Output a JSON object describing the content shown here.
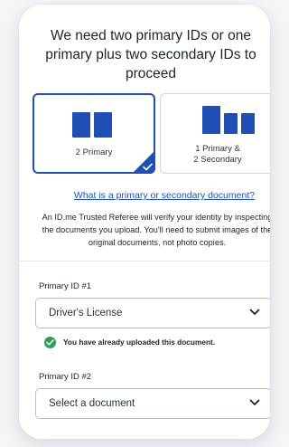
{
  "header": {
    "title": "We need two primary IDs or one primary plus two secondary IDs to proceed"
  },
  "options": {
    "two_primary": {
      "label": "2 Primary",
      "selected": true
    },
    "primary_secondary": {
      "label_line1": "1 Primary &",
      "label_line2": "2 Secondary",
      "selected": false
    }
  },
  "help": {
    "link": "What is a primary or secondary document?",
    "description": "An ID.me Trusted Referee will verify your identity by inspecting the documents you upload. You'll need to submit images of the original documents, not photo copies."
  },
  "primary_id_1": {
    "label": "Primary ID #1",
    "value": "Driver's License",
    "status": "You have already uploaded this document."
  },
  "primary_id_2": {
    "label": "Primary ID #2",
    "placeholder": "Select a document"
  },
  "colors": {
    "accent": "#1f4fb4",
    "success": "#2f9e5b",
    "text": "#1c2430"
  },
  "icons": {
    "selected": "checkmark-icon",
    "dropdown": "chevron-down-icon",
    "success": "check-circle-icon"
  }
}
